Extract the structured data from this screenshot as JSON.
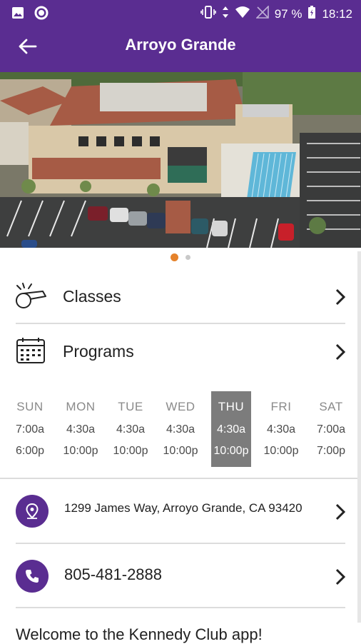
{
  "status_bar": {
    "battery": "97 %",
    "time": "18:12"
  },
  "toolbar": {
    "title": "Arroyo Grande"
  },
  "carousel": {
    "page_count": 2,
    "active_index": 0,
    "accent_color": "#e5822b"
  },
  "menu": {
    "classes_label": "Classes",
    "programs_label": "Programs"
  },
  "hours": [
    {
      "day": "SUN",
      "open": "7:00a",
      "close": "6:00p"
    },
    {
      "day": "MON",
      "open": "4:30a",
      "close": "10:00p"
    },
    {
      "day": "TUE",
      "open": "4:30a",
      "close": "10:00p"
    },
    {
      "day": "WED",
      "open": "4:30a",
      "close": "10:00p"
    },
    {
      "day": "THU",
      "open": "4:30a",
      "close": "10:00p"
    },
    {
      "day": "FRI",
      "open": "4:30a",
      "close": "10:00p"
    },
    {
      "day": "SAT",
      "open": "7:00a",
      "close": "7:00p"
    }
  ],
  "active_day": "THU",
  "contact": {
    "address": "1299 James Way, Arroyo Grande, CA 93420",
    "phone": "805-481-2888"
  },
  "welcome": "Welcome to the Kennedy Club app!",
  "colors": {
    "primary": "#5a2d91",
    "accent": "#e5822b",
    "active_day_bg": "#7c7c7c"
  }
}
